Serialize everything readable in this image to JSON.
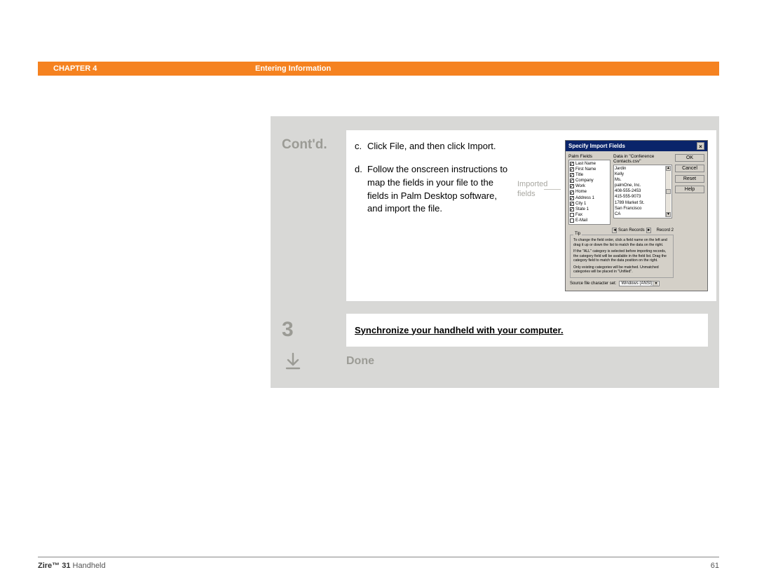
{
  "header": {
    "chapter": "CHAPTER 4",
    "section": "Entering Information"
  },
  "contd": {
    "label": "Cont'd.",
    "items": [
      {
        "letter": "c.",
        "text": "Click File, and then click Import."
      },
      {
        "letter": "d.",
        "text": "Follow the onscreen instructions to map the fields in your file to the fields in Palm Desktop software, and import the file."
      }
    ],
    "callout": "Imported fields"
  },
  "dialog": {
    "title": "Specify Import Fields",
    "palm_fields_label": "Palm Fields",
    "data_label": "Data in \"Conference Contacts.csv\"",
    "fields": [
      {
        "checked": true,
        "name": "Last Name",
        "value": "Jardin"
      },
      {
        "checked": true,
        "name": "First Name",
        "value": "Kelly"
      },
      {
        "checked": true,
        "name": "Title",
        "value": "Ms."
      },
      {
        "checked": true,
        "name": "Company",
        "value": "palmOne, Inc."
      },
      {
        "checked": true,
        "name": "Work",
        "value": "408-555-2453"
      },
      {
        "checked": true,
        "name": "Home",
        "value": "415-555-9073"
      },
      {
        "checked": true,
        "name": "Address 1",
        "value": "1789 Market St."
      },
      {
        "checked": true,
        "name": "City 1",
        "value": "San Francisco"
      },
      {
        "checked": true,
        "name": "State 1",
        "value": "CA"
      },
      {
        "checked": false,
        "name": "Fax",
        "value": ""
      },
      {
        "checked": false,
        "name": "E-Mail",
        "value": ""
      }
    ],
    "buttons": {
      "ok": "OK",
      "cancel": "Cancel",
      "reset": "Reset",
      "help": "Help"
    },
    "scan": {
      "label": "Scan Records",
      "record": "Record 2"
    },
    "tip": {
      "label": "Tip",
      "p1": "To change the field order, click a field name on the left and drag it up or down the list to match the data on the right.",
      "p2": "If the \"ALL\" category is selected before importing records, the category field will be available in the field list. Drag the category field to match the data position on the right.",
      "p3": "Only existing categories will be matched. Unmatched categories will be placed in \"Unfiled\"."
    },
    "charset": {
      "label": "Source file character set:",
      "value": "Windows (ANSI)"
    }
  },
  "step3": {
    "num": "3",
    "link": "Synchronize your handheld with your computer."
  },
  "done": {
    "label": "Done"
  },
  "footer": {
    "product_bold": "Zire™ 31",
    "product_rest": " Handheld",
    "page": "61"
  }
}
